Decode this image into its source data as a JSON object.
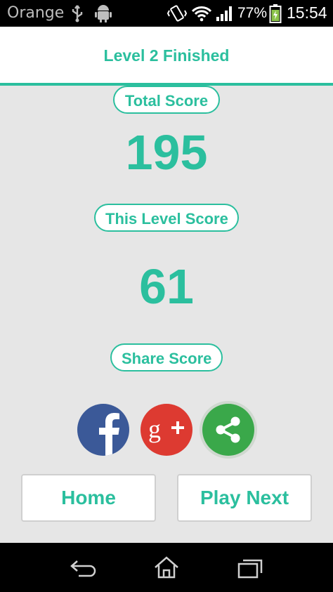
{
  "status_bar": {
    "carrier": "Orange",
    "battery_percent": "77%",
    "time": "15:54",
    "icons": [
      "usb-icon",
      "android-icon",
      "vibrate-icon",
      "wifi-icon",
      "signal-icon",
      "battery-charging-icon"
    ]
  },
  "header": {
    "title": "Level 2 Finished"
  },
  "scores": {
    "total_label": "Total Score",
    "total_value": "195",
    "level_label": "This Level Score",
    "level_value": "61"
  },
  "share": {
    "label": "Share Score",
    "buttons": [
      "facebook-icon",
      "google-plus-icon",
      "share-icon"
    ]
  },
  "actions": {
    "home": "Home",
    "play_next": "Play Next"
  },
  "navigation": [
    "back-icon",
    "home-nav-icon",
    "recent-apps-icon"
  ],
  "colors": {
    "accent": "#2bbf9e",
    "facebook": "#3b5998",
    "google_plus": "#dd3a31",
    "share": "#3aa84a",
    "background": "#e6e6e6"
  }
}
